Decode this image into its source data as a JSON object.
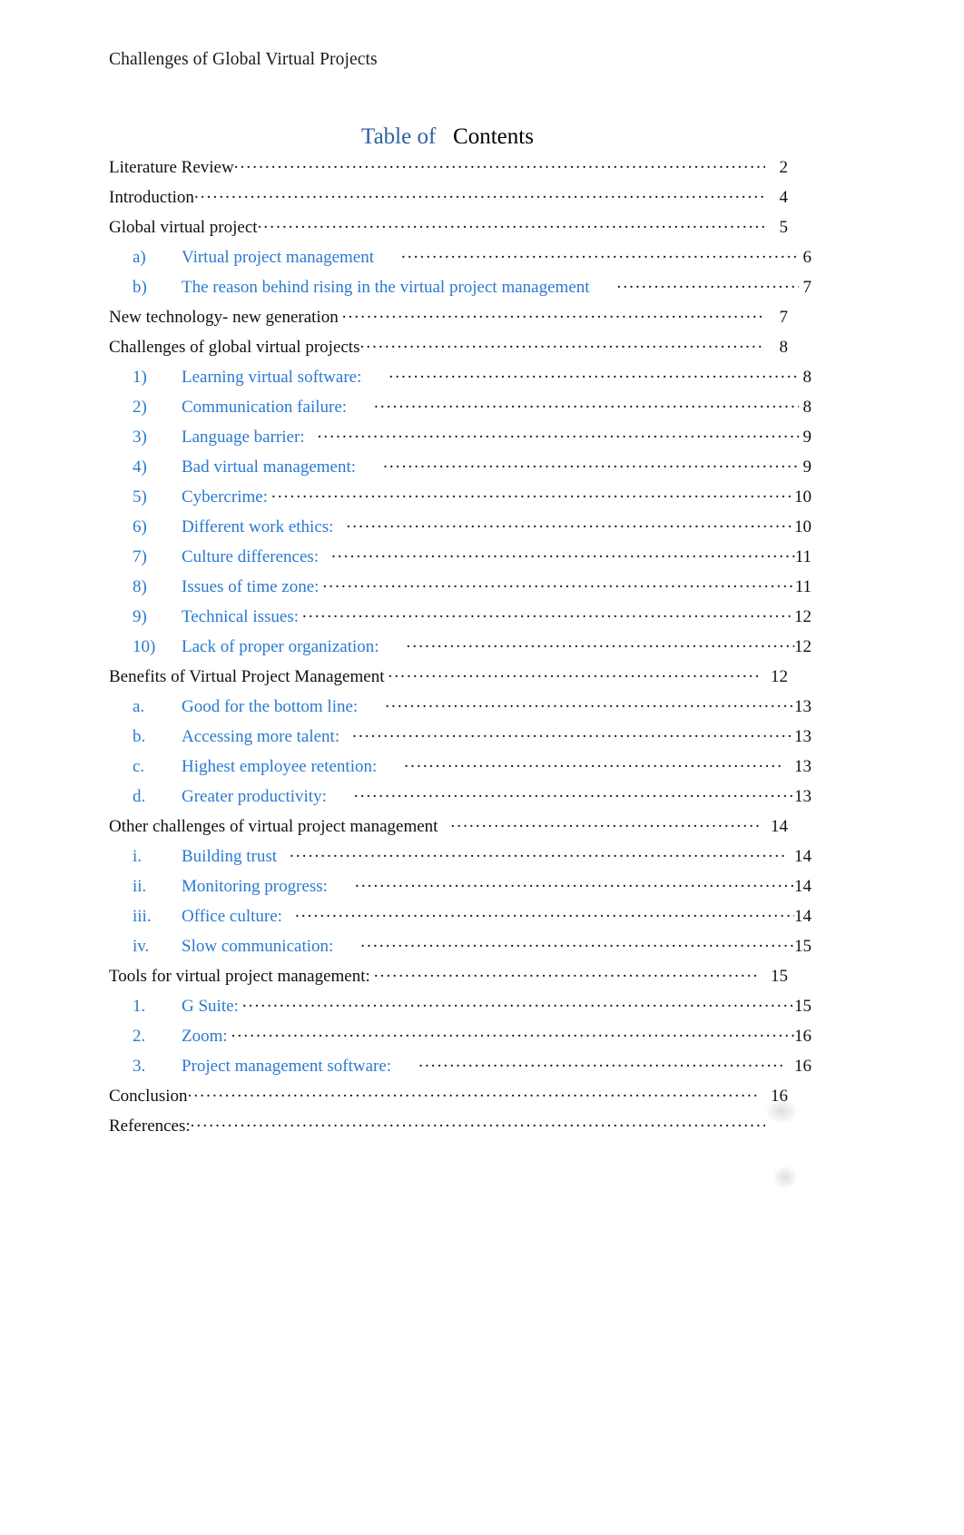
{
  "document": {
    "running_header": "Challenges of Global Virtual Projects",
    "title_blue": "Table of",
    "title_black": "Contents",
    "accent_blue": "#2a7ad1",
    "title_blue_color": "#2e5fa3",
    "text_color": "#111111",
    "background": "#ffffff"
  },
  "toc": {
    "entries": [
      {
        "level": 1,
        "marker": "",
        "label": "Literature Review",
        "page": "2",
        "leader_gap": "none",
        "page_pad": "wide"
      },
      {
        "level": 1,
        "marker": "",
        "label": "Introduction",
        "page": "4",
        "leader_gap": "none",
        "page_pad": "wide"
      },
      {
        "level": 1,
        "marker": "",
        "label": "Global virtual project",
        "page": "5",
        "leader_gap": "none",
        "page_pad": "wide"
      },
      {
        "level": 2,
        "marker": "a)",
        "label": "Virtual project management",
        "page": "6",
        "leader_gap": "large",
        "page_pad": "narrow"
      },
      {
        "level": 2,
        "marker": "b)",
        "label": "The reason behind rising in the virtual project management",
        "page": "7",
        "leader_gap": "large",
        "page_pad": "narrow"
      },
      {
        "level": 1,
        "marker": "",
        "label": "New technology- new generation",
        "page": "7",
        "leader_gap": "small",
        "page_pad": "wide"
      },
      {
        "level": 1,
        "marker": "",
        "label": "Challenges of global virtual projects",
        "page": "8",
        "leader_gap": "none",
        "page_pad": "wide"
      },
      {
        "level": 2,
        "marker": "1)",
        "label": "Learning virtual software:",
        "page": "8",
        "leader_gap": "large",
        "page_pad": "narrow"
      },
      {
        "level": 2,
        "marker": "2)",
        "label": "Communication failure:",
        "page": "8",
        "leader_gap": "large",
        "page_pad": "narrow"
      },
      {
        "level": 2,
        "marker": "3)",
        "label": "Language barrier:",
        "page": "9",
        "leader_gap": "medium",
        "page_pad": "narrow"
      },
      {
        "level": 2,
        "marker": "4)",
        "label": "Bad virtual management:",
        "page": "9",
        "leader_gap": "large",
        "page_pad": "narrow"
      },
      {
        "level": 2,
        "marker": "5)",
        "label": "Cybercrime:",
        "page": "10",
        "leader_gap": "small",
        "page_pad": "narrow"
      },
      {
        "level": 2,
        "marker": "6)",
        "label": "Different work ethics:",
        "page": "10",
        "leader_gap": "medium",
        "page_pad": "narrow"
      },
      {
        "level": 2,
        "marker": "7)",
        "label": "Culture differences:",
        "page": "11",
        "leader_gap": "medium",
        "page_pad": "narrow"
      },
      {
        "level": 2,
        "marker": "8)",
        "label": "Issues of time zone:",
        "page": "11",
        "leader_gap": "small",
        "page_pad": "narrow"
      },
      {
        "level": 2,
        "marker": "9)",
        "label": "Technical issues:",
        "page": "12",
        "leader_gap": "small",
        "page_pad": "narrow"
      },
      {
        "level": 2,
        "marker": "10)",
        "label": "Lack of proper organization:",
        "page": "12",
        "leader_gap": "large",
        "page_pad": "narrow"
      },
      {
        "level": 1,
        "marker": "",
        "label": "Benefits of Virtual Project Management",
        "page": "12",
        "leader_gap": "small",
        "page_pad": "wide"
      },
      {
        "level": 2,
        "marker": "a.",
        "label": "Good for the bottom line:",
        "page": "13",
        "leader_gap": "large",
        "page_pad": "narrow"
      },
      {
        "level": 2,
        "marker": "b.",
        "label": "Accessing more talent:",
        "page": "13",
        "leader_gap": "medium",
        "page_pad": "narrow"
      },
      {
        "level": 2,
        "marker": "c.",
        "label": "Highest employee retention:",
        "page": "13",
        "leader_gap": "large",
        "page_pad": "wide"
      },
      {
        "level": 2,
        "marker": "d.",
        "label": "Greater productivity:",
        "page": "13",
        "leader_gap": "large",
        "page_pad": "narrow"
      },
      {
        "level": 1,
        "marker": "",
        "label": "Other challenges of virtual project management",
        "page": "14",
        "leader_gap": "medium",
        "page_pad": "wide"
      },
      {
        "level": 2,
        "marker": "i.",
        "label": "Building trust",
        "page": "14",
        "leader_gap": "medium",
        "page_pad": "wide"
      },
      {
        "level": 2,
        "marker": "ii.",
        "label": "Monitoring progress:",
        "page": "14",
        "leader_gap": "large",
        "page_pad": "narrow"
      },
      {
        "level": 2,
        "marker": "iii.",
        "label": "Office culture:",
        "page": "14",
        "leader_gap": "medium",
        "page_pad": "narrow"
      },
      {
        "level": 2,
        "marker": "iv.",
        "label": "Slow communication:",
        "page": "15",
        "leader_gap": "large",
        "page_pad": "narrow"
      },
      {
        "level": 1,
        "marker": "",
        "label": "Tools for virtual project management:",
        "page": "15",
        "leader_gap": "small",
        "page_pad": "wide"
      },
      {
        "level": 2,
        "marker": "1.",
        "label": "G Suite:",
        "page": "15",
        "leader_gap": "small",
        "page_pad": "narrow"
      },
      {
        "level": 2,
        "marker": "2.",
        "label": "Zoom:",
        "page": "16",
        "leader_gap": "small",
        "page_pad": "narrow"
      },
      {
        "level": 2,
        "marker": "3.",
        "label": "Project management software:",
        "page": "16",
        "leader_gap": "large",
        "page_pad": "wide"
      },
      {
        "level": 1,
        "marker": "",
        "label": "Conclusion",
        "page": "16",
        "leader_gap": "none",
        "page_pad": "wide"
      },
      {
        "level": 1,
        "marker": "",
        "label": "References:",
        "page": "",
        "leader_gap": "none",
        "page_pad": "wide"
      }
    ]
  }
}
